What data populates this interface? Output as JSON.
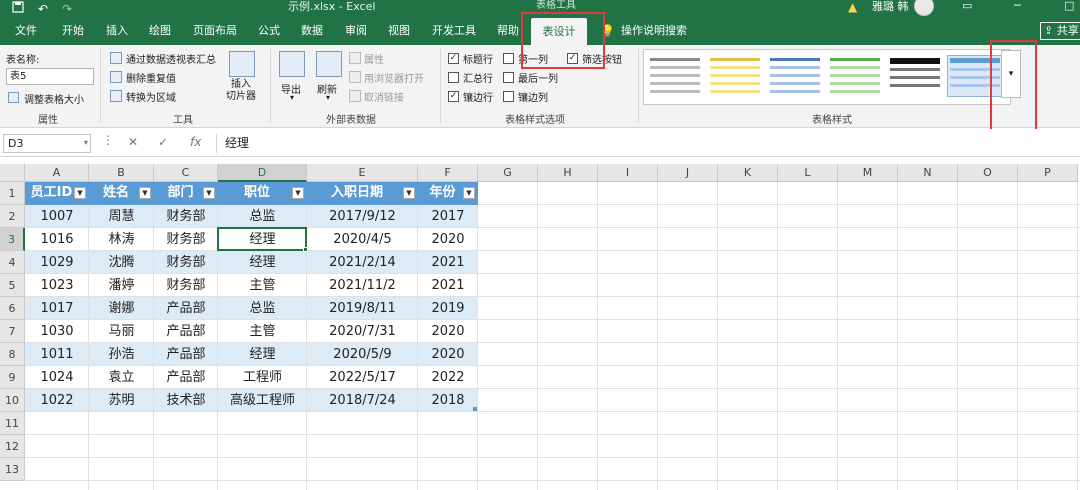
{
  "titlebar": {
    "doc_title": "示例.xlsx  -  Excel",
    "context_title": "表格工具",
    "user": "雅璐 韩",
    "qat_save_icon": "save-icon",
    "qat_undo_icon": "undo-icon",
    "qat_redo_icon": "redo-icon"
  },
  "tabs": {
    "file": "文件",
    "home": "开始",
    "insert": "插入",
    "draw": "绘图",
    "page_layout": "页面布局",
    "formulas": "公式",
    "data": "数据",
    "review": "审阅",
    "view": "视图",
    "developer": "开发工具",
    "help": "帮助",
    "table_design": "表设计",
    "tell_me": "操作说明搜索",
    "share": "共享"
  },
  "ribbon": {
    "properties": {
      "group_label": "属性",
      "table_name_label": "表名称:",
      "table_name_value": "表5",
      "resize": "调整表格大小"
    },
    "tools": {
      "group_label": "工具",
      "summarize_pivot": "通过数据透视表汇总",
      "remove_duplicates": "删除重复值",
      "convert_range": "转换为区域",
      "insert_slicer": "插入\n切片器"
    },
    "external": {
      "group_label": "外部表数据",
      "export": "导出",
      "refresh": "刷新",
      "properties": "属性",
      "open_browser": "用浏览器打开",
      "unlink": "取消链接"
    },
    "style_options": {
      "group_label": "表格样式选项",
      "header_row": "标题行",
      "first_column": "第一列",
      "filter_button": "筛选按钮",
      "total_row": "汇总行",
      "last_column": "最后一列",
      "banded_rows": "镶边行",
      "banded_columns": "镶边列"
    },
    "styles": {
      "group_label": "表格样式"
    }
  },
  "formula_bar": {
    "name_box": "D3",
    "cancel_symbol": "✕",
    "enter_symbol": "✓",
    "fx_symbol": "fx",
    "content": "经理"
  },
  "columns": [
    "A",
    "B",
    "C",
    "D",
    "E",
    "F",
    "G",
    "H",
    "I",
    "J",
    "K",
    "L",
    "M",
    "N",
    "O",
    "P"
  ],
  "rows": [
    "1",
    "2",
    "3",
    "4",
    "5",
    "6",
    "7",
    "8",
    "9",
    "10",
    "11",
    "12",
    "13"
  ],
  "table": {
    "headers": [
      "员工ID",
      "姓名",
      "部门",
      "职位",
      "入职日期",
      "年份"
    ],
    "rows": [
      [
        "1007",
        "周慧",
        "财务部",
        "总监",
        "2017/9/12",
        "2017"
      ],
      [
        "1016",
        "林涛",
        "财务部",
        "经理",
        "2020/4/5",
        "2020"
      ],
      [
        "1029",
        "沈腾",
        "财务部",
        "经理",
        "2021/2/14",
        "2021"
      ],
      [
        "1023",
        "潘婷",
        "财务部",
        "主管",
        "2021/11/2",
        "2021"
      ],
      [
        "1017",
        "谢娜",
        "产品部",
        "总监",
        "2019/8/11",
        "2019"
      ],
      [
        "1030",
        "马丽",
        "产品部",
        "主管",
        "2020/7/31",
        "2020"
      ],
      [
        "1011",
        "孙浩",
        "产品部",
        "经理",
        "2020/5/9",
        "2020"
      ],
      [
        "1024",
        "袁立",
        "产品部",
        "工程师",
        "2022/5/17",
        "2022"
      ],
      [
        "1022",
        "苏明",
        "技术部",
        "高级工程师",
        "2018/7/24",
        "2018"
      ]
    ]
  },
  "colors": {
    "excel_green": "#217346",
    "table_header": "#5b9bd5",
    "band": "#ddebf7",
    "highlight": "#e13a3a"
  }
}
